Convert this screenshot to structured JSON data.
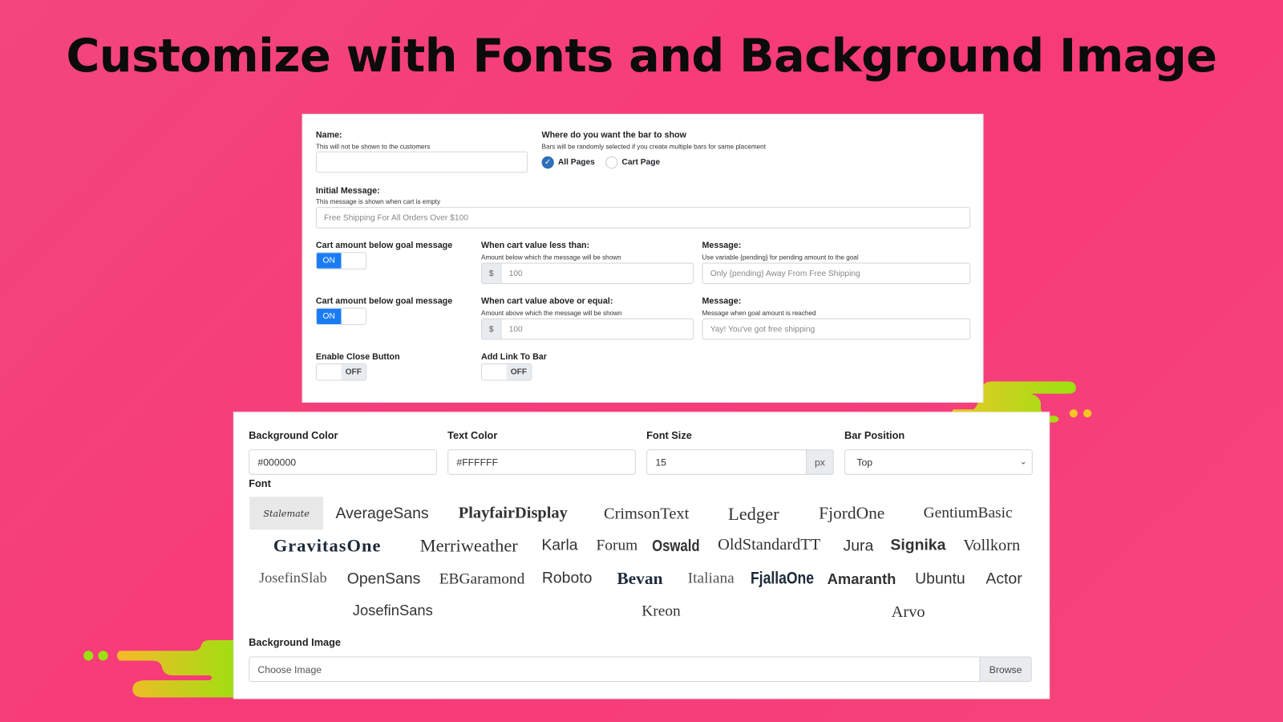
{
  "title": "Customize with Fonts and Background Image",
  "colors": {
    "background": "#f73a78",
    "accent": "#1a7cf5",
    "decoration_green": "#9be10f",
    "decoration_yellow": "#f5c524"
  },
  "bar_settings": {
    "name": {
      "label": "Name:",
      "hint": "This will not be shown to the customers",
      "value": ""
    },
    "placement": {
      "label": "Where do you want the bar to show",
      "hint": "Bars will be randomly selected if you create multiple bars for same placement",
      "options": [
        {
          "label": "All Pages",
          "checked": true
        },
        {
          "label": "Cart Page",
          "checked": false
        }
      ]
    },
    "initial_message": {
      "label": "Initial Message:",
      "hint": "This message is shown when cart is empty",
      "placeholder": "Free Shipping For All Orders Over $100"
    },
    "below_goal": {
      "label": "Cart amount below goal message",
      "toggle": "ON",
      "amount_label": "When cart value less than:",
      "amount_hint": "Amount below which the message will be shown",
      "currency": "$",
      "amount": "100",
      "message_label": "Message:",
      "message_hint": "Use variable {pending} for pending amount to the goal",
      "message_placeholder": "Only {pending} Away From Free Shipping"
    },
    "above_goal": {
      "label": "Cart amount below goal message",
      "toggle": "ON",
      "amount_label": "When cart value above or equal:",
      "amount_hint": "Amount above which the message will be shown",
      "currency": "$",
      "amount": "100",
      "message_label": "Message:",
      "message_hint": "Message when goal amount is reached",
      "message_placeholder": "Yay! You've got free shipping"
    },
    "close_button": {
      "label": "Enable Close Button",
      "toggle": "OFF"
    },
    "link": {
      "label": "Add Link To Bar",
      "toggle": "OFF"
    }
  },
  "style_settings": {
    "background_color": {
      "label": "Background Color",
      "value": "#000000"
    },
    "text_color": {
      "label": "Text Color",
      "value": "#FFFFFF"
    },
    "font_size": {
      "label": "Font Size",
      "value": "15",
      "unit": "px"
    },
    "bar_position": {
      "label": "Bar Position",
      "value": "Top"
    },
    "font_label": "Font",
    "selected_font": "Stalemate",
    "fonts": [
      "Stalemate",
      "AverageSans",
      "PlayfairDisplay",
      "CrimsonText",
      "Ledger",
      "FjordOne",
      "GentiumBasic",
      "GravitasOne",
      "Merriweather",
      "Karla",
      "Forum",
      "Oswald",
      "OldStandardTT",
      "Jura",
      "Signika",
      "Vollkorn",
      "JosefinSlab",
      "OpenSans",
      "EBGaramond",
      "Roboto",
      "Bevan",
      "Italiana",
      "FjallaOne",
      "Amaranth",
      "Ubuntu",
      "Actor",
      "JosefinSans",
      "Kreon",
      "Arvo"
    ],
    "background_image": {
      "label": "Background Image",
      "placeholder": "Choose Image",
      "button": "Browse"
    }
  }
}
